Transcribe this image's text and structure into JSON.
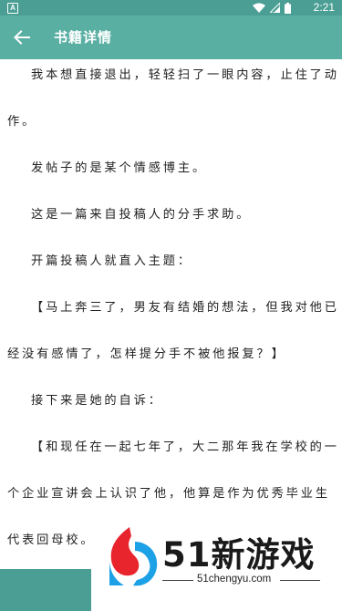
{
  "status_bar": {
    "app_icon_letter": "A",
    "time": "2:21",
    "icons": [
      "wifi-icon",
      "signal-icon",
      "battery-icon"
    ]
  },
  "app_bar": {
    "back_icon": "arrow-left-icon",
    "title": "书籍详情"
  },
  "article": {
    "lines": [
      "我本想直接退出，轻轻扫了一眼内容，止住了动",
      "作。",
      "发帖子的是某个情感博主。",
      "这是一篇来自投稿人的分手求助。",
      "开篇投稿人就直入主题：",
      "【马上奔三了，男友有结婚的想法，但我对他已",
      "经没有感情了，怎样提分手不被他报复？】",
      "接下来是她的自诉：",
      "【和现任在一起七年了，大二那年我在学校的一",
      "个企业宣讲会上认识了他，他算是作为优秀毕业生",
      "代表回母校。"
    ]
  },
  "watermark": {
    "brand": "51新游戏",
    "domain": "51chengyu.com"
  },
  "colors": {
    "status_bar": "#4a9e94",
    "app_bar": "#5aafa3",
    "text": "#222222",
    "logo_red": "#e8242c",
    "logo_blue": "#1da1e6"
  }
}
